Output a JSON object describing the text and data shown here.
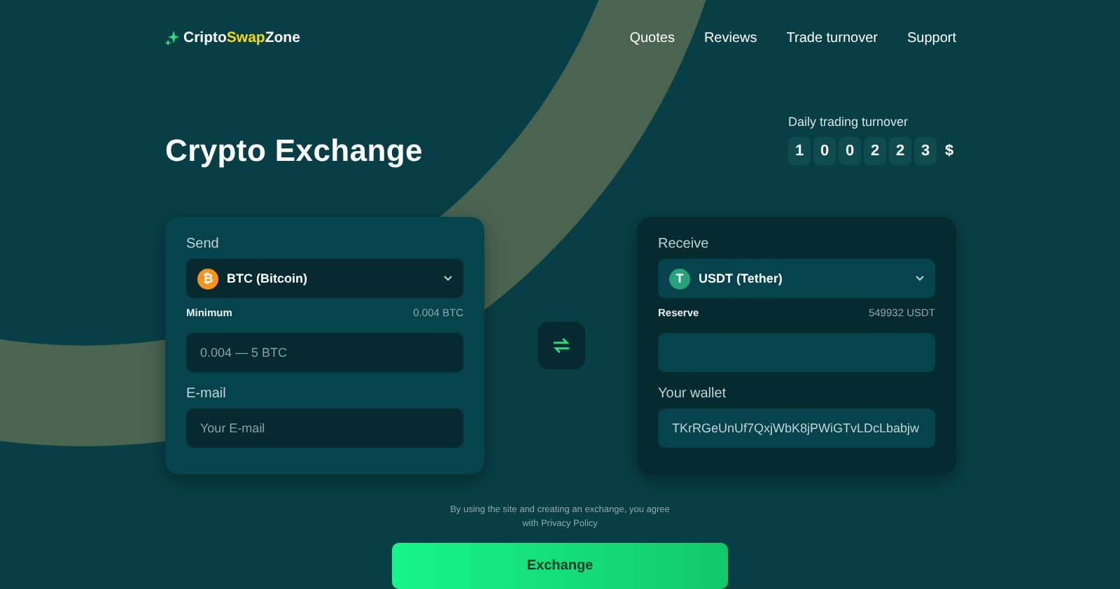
{
  "brand": {
    "prefix": "Cripto",
    "highlight": "Swap",
    "suffix": "Zone"
  },
  "nav": [
    "Quotes",
    "Reviews",
    "Trade turnover",
    "Support"
  ],
  "title": "Crypto Exchange",
  "turnover": {
    "label": "Daily trading turnover",
    "digits": [
      "1",
      "0",
      "0",
      "2",
      "2",
      "3"
    ],
    "currency": "$"
  },
  "cards": [
    {
      "kind": "send",
      "title": "Send",
      "currency": {
        "kind": "btc",
        "name": "BTC (Bitcoin)",
        "symbol": "₿"
      },
      "info_label": "Minimum",
      "info_value": "0.004 BTC",
      "amount": {
        "placeholder": "0.004 — 5 BTC"
      },
      "second_label": "E-mail",
      "second_field": {
        "placeholder": "Your E-mail"
      }
    },
    {
      "kind": "receive",
      "title": "Receive",
      "currency": {
        "kind": "usdt",
        "name": "USDT (Tether)",
        "symbol": "T"
      },
      "info_label": "Reserve",
      "info_value": "549932 USDT",
      "second_label": "Your wallet",
      "second_field": {
        "value": "TKrRGeUnUf7QxjWbK8jPWiGTvLDcLbabjw"
      }
    }
  ],
  "agreement": [
    "By using the site and creating an exchange, you agree",
    "with Privacy Policy"
  ],
  "button": "Exchange"
}
